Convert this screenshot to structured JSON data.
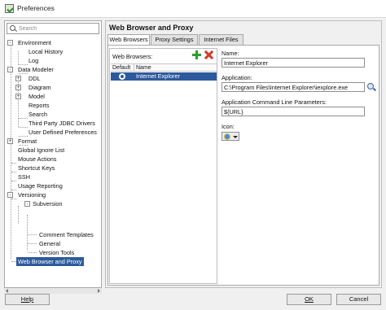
{
  "window": {
    "title": "Preferences"
  },
  "search": {
    "placeholder": "Search"
  },
  "tree": [
    {
      "label": "Environment",
      "expander": "-"
    },
    {
      "label": "Local History"
    },
    {
      "label": "Log"
    },
    {
      "label": "Data Modeler",
      "expander": "-"
    },
    {
      "label": "DDL",
      "expander": "+"
    },
    {
      "label": "Diagram",
      "expander": "+"
    },
    {
      "label": "Model",
      "expander": "+"
    },
    {
      "label": "Reports"
    },
    {
      "label": "Search"
    },
    {
      "label": "Third Party JDBC Drivers"
    },
    {
      "label": "User Defined Preferences"
    },
    {
      "label": "Format",
      "expander": "+"
    },
    {
      "label": "Global Ignore List"
    },
    {
      "label": "Mouse Actions"
    },
    {
      "label": "Shortcut Keys"
    },
    {
      "label": "SSH"
    },
    {
      "label": "Usage Reporting"
    },
    {
      "label": "Versioning",
      "expander": "-"
    },
    {
      "label": "Subversion",
      "expander": "-"
    },
    {
      "label": "Comment Templates"
    },
    {
      "label": "General"
    },
    {
      "label": "Version Tools"
    },
    {
      "label": "Web Browser and Proxy",
      "selected": true
    }
  ],
  "panel": {
    "title": "Web Browser and Proxy",
    "tabs": [
      "Web Browsers",
      "Proxy Settings",
      "Internet Files"
    ],
    "active_tab": "Web Browsers"
  },
  "browsers": {
    "label": "Web Browsers:",
    "columns": [
      "Default",
      "Name"
    ],
    "rows": [
      {
        "name": "Internet Explorer",
        "default": true
      }
    ]
  },
  "form": {
    "name_label": "Name:",
    "name_value": "Internet Explorer",
    "application_label": "Application:",
    "application_value": "C:\\Program Files\\Internet Explorer\\iexplore.exe",
    "params_label": "Application Command Line Parameters:",
    "params_value": "${URL}",
    "icon_label": "Icon:"
  },
  "icons": {
    "app": "preferences-icon",
    "search": "search-icon",
    "add": "add-icon",
    "remove": "remove-icon",
    "browse": "browse-icon",
    "browser": "ie-icon"
  },
  "buttons": {
    "help": "Help",
    "ok": "OK",
    "cancel": "Cancel"
  },
  "colors": {
    "selection": "#2d5a9c",
    "add": "#2e9a2e",
    "remove": "#d43a2a"
  }
}
